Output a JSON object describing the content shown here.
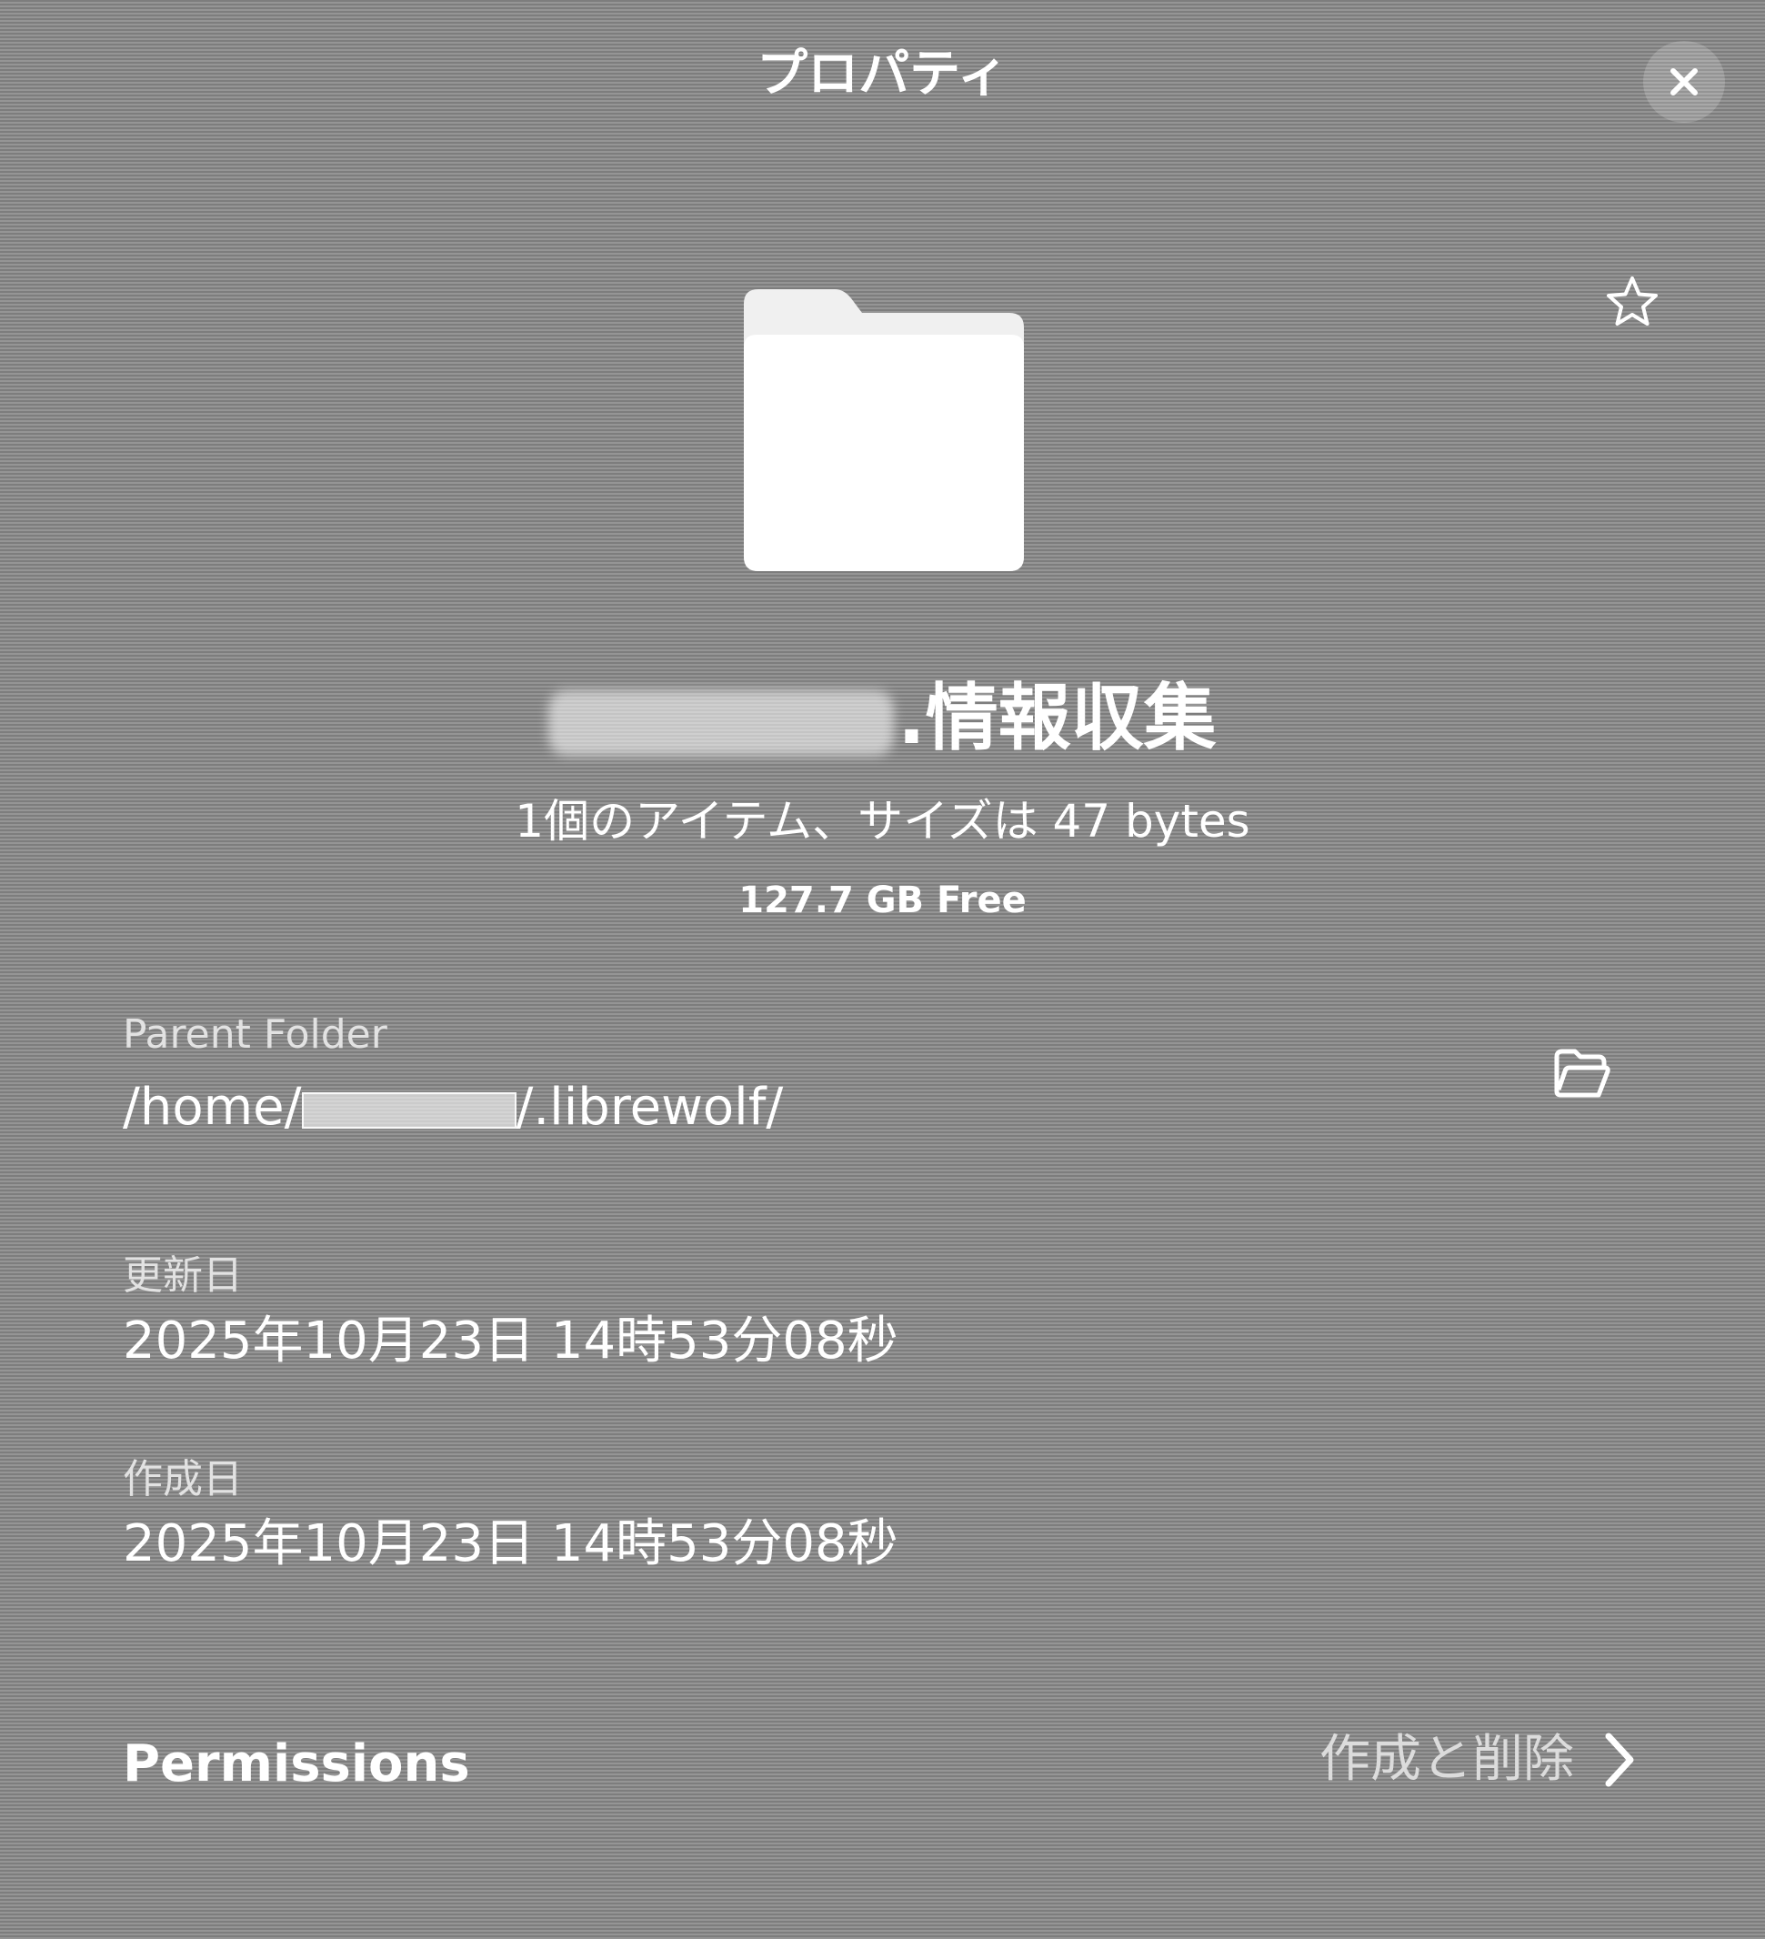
{
  "dialog": {
    "title": "プロパティ",
    "close_icon": "close-icon",
    "star_icon": "star-icon"
  },
  "file": {
    "icon": "folder-icon",
    "name_visible": ".情報収集",
    "summary": "1個のアイテム、サイズは 47 bytes",
    "free_space": "127.7 GB Free"
  },
  "details": {
    "parent_folder": {
      "label": "Parent Folder",
      "prefix": "/home/",
      "suffix": "/.librewolf/",
      "open_icon": "folder-open-icon"
    },
    "modified": {
      "label": "更新日",
      "value": "2025年10月23日 14時53分08秒"
    },
    "created": {
      "label": "作成日",
      "value": "2025年10月23日 14時53分08秒"
    }
  },
  "footer": {
    "permissions_label": "Permissions",
    "create_delete_label": "作成と削除",
    "chevron_icon": "chevron-right-icon"
  }
}
